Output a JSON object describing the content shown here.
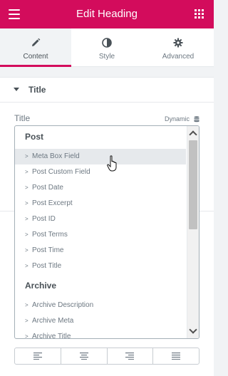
{
  "header": {
    "title": "Edit Heading"
  },
  "tabs": [
    {
      "label": "Content",
      "icon": "pencil-icon",
      "active": true
    },
    {
      "label": "Style",
      "icon": "contrast-icon",
      "active": false
    },
    {
      "label": "Advanced",
      "icon": "gear-icon",
      "active": false
    }
  ],
  "section": {
    "title": "Title"
  },
  "field": {
    "label": "Title",
    "dynamic_label": "Dynamic"
  },
  "dropdown": {
    "groups": [
      {
        "label": "Post",
        "items": [
          "Meta Box Field",
          "Post Custom Field",
          "Post Date",
          "Post Excerpt",
          "Post ID",
          "Post Terms",
          "Post Time",
          "Post Title"
        ]
      },
      {
        "label": "Archive",
        "items": [
          "Archive Description",
          "Archive Meta",
          "Archive Title"
        ]
      }
    ],
    "hovered_item": "Meta Box Field",
    "bullet": ">"
  },
  "alignment": [
    "align-left-icon",
    "align-center-icon",
    "align-right-icon",
    "align-justify-icon"
  ],
  "colors": {
    "accent": "#d30c5c",
    "text": "#495157",
    "muted": "#6d7882"
  }
}
